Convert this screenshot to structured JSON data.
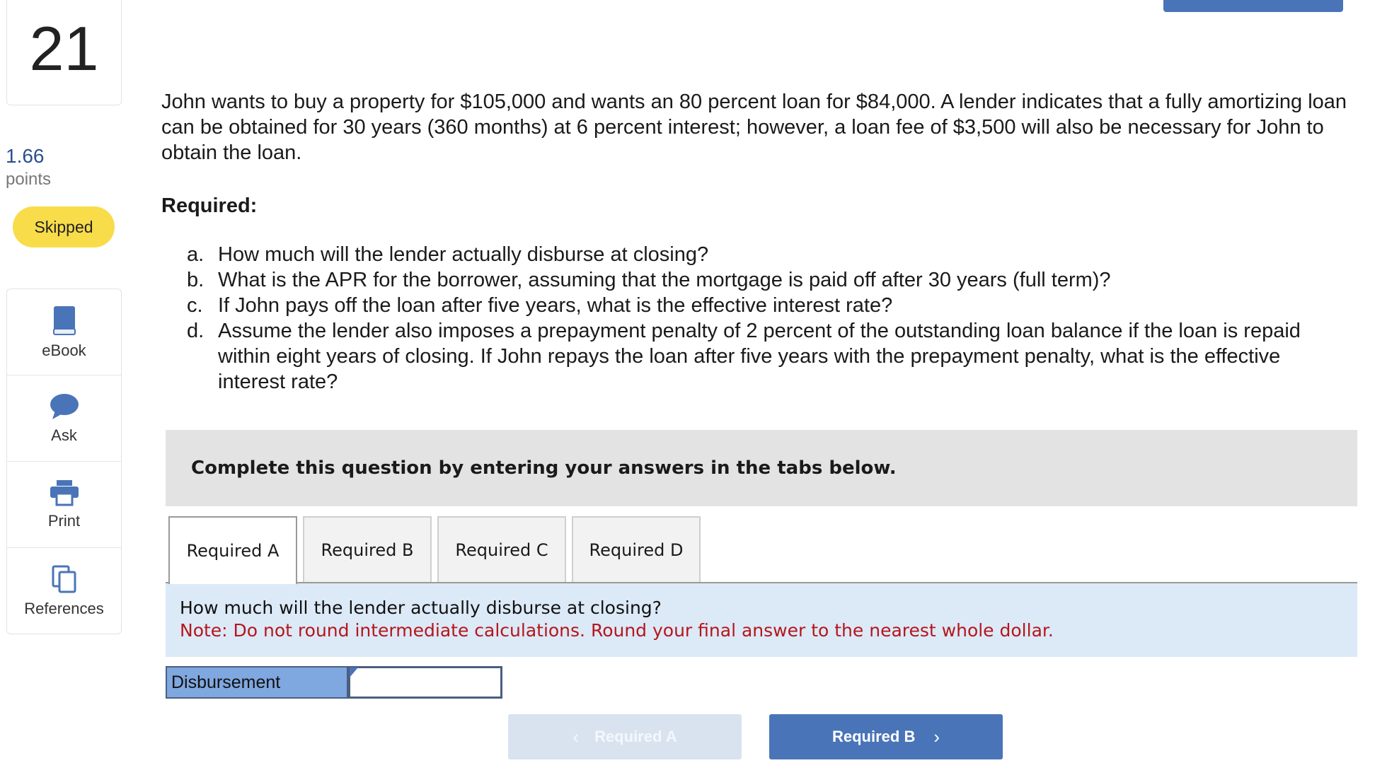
{
  "question": {
    "number": "21",
    "points_value": "1.66",
    "points_label": "points",
    "status": "Skipped",
    "intro": "John wants to buy a property for $105,000 and wants an 80 percent loan for $84,000. A lender indicates that a fully amortizing loan can be obtained for 30 years (360 months) at 6 percent interest; however, a loan fee of $3,500 will also be necessary for John to obtain the loan.",
    "required_heading": "Required:",
    "requirements": [
      {
        "letter": "a.",
        "text": "How much will the lender actually disburse at closing?"
      },
      {
        "letter": "b.",
        "text": "What is the APR for the borrower, assuming that the mortgage is paid off after 30 years (full term)?"
      },
      {
        "letter": "c.",
        "text": "If John pays off the loan after five years, what is the effective interest rate?"
      },
      {
        "letter": "d.",
        "text": "Assume the lender also imposes a prepayment penalty of 2 percent of the outstanding loan balance if the loan is repaid within eight years of closing. If John repays the loan after five years with the prepayment penalty, what is the effective interest rate?"
      }
    ]
  },
  "tools": {
    "ebook": "eBook",
    "ask": "Ask",
    "print": "Print",
    "references": "References"
  },
  "instructions": "Complete this question by entering your answers in the tabs below.",
  "tabs": [
    {
      "label": "Required A",
      "active": true
    },
    {
      "label": "Required B",
      "active": false
    },
    {
      "label": "Required C",
      "active": false
    },
    {
      "label": "Required D",
      "active": false
    }
  ],
  "panel": {
    "question": "How much will the lender actually disburse at closing?",
    "note": "Note: Do not round intermediate calculations. Round your final answer to the nearest whole dollar."
  },
  "answer": {
    "label": "Disbursement",
    "value": ""
  },
  "nav": {
    "prev_label": "Required A",
    "next_label": "Required B"
  },
  "colors": {
    "accent": "#4a74b8",
    "badge": "#f8dc4a",
    "note": "#b5161b",
    "panel_bg": "#dce9f7"
  }
}
